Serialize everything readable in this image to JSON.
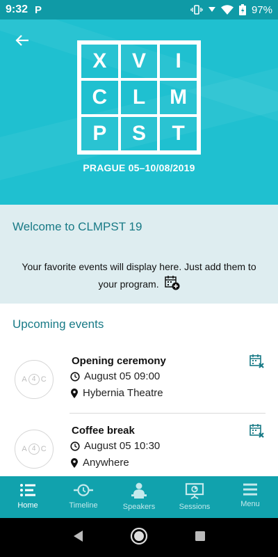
{
  "status_bar": {
    "time": "9:32",
    "app_badge": "P",
    "battery": "97%"
  },
  "hero": {
    "logo_letters": [
      "X",
      "V",
      "I",
      "C",
      "L",
      "M",
      "P",
      "S",
      "T"
    ],
    "subtitle": "PRAGUE 05–10/08/2019"
  },
  "welcome": {
    "title": "Welcome to CLMPST 19",
    "message": "Your favorite events will display here. Just add them to your program."
  },
  "upcoming": {
    "title": "Upcoming events",
    "events": [
      {
        "name": "Opening ceremony",
        "datetime": "August 05 09:00",
        "location": "Hybernia Theatre"
      },
      {
        "name": "Coffee break",
        "datetime": "August 05 10:30",
        "location": "Anywhere"
      }
    ]
  },
  "bottom_nav": {
    "items": [
      {
        "label": "Home",
        "icon": "list-icon",
        "active": true
      },
      {
        "label": "Timeline",
        "icon": "timeline-icon",
        "active": false
      },
      {
        "label": "Speakers",
        "icon": "speaker-icon",
        "active": false
      },
      {
        "label": "Sessions",
        "icon": "presentation-icon",
        "active": false
      },
      {
        "label": "Menu",
        "icon": "hamburger-icon",
        "active": false
      }
    ]
  },
  "colors": {
    "primary": "#1fc0d0",
    "nav_bar": "#11a2ad",
    "accent_text": "#187a86",
    "welcome_bg": "#deedf0"
  }
}
